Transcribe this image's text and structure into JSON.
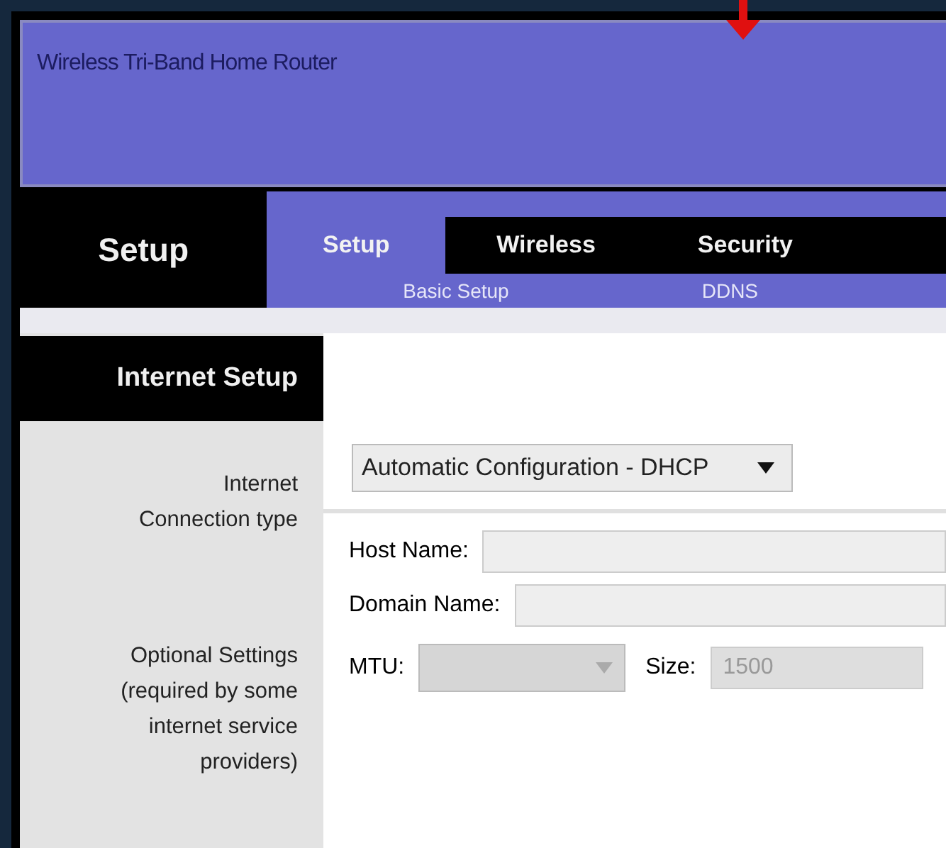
{
  "header": {
    "title": "Wireless Tri-Band Home Router"
  },
  "section": {
    "title": "Setup"
  },
  "tabs": [
    {
      "label": "Setup",
      "selected": true
    },
    {
      "label": "Wireless",
      "selected": false
    },
    {
      "label": "Security",
      "selected": false
    }
  ],
  "subtabs": [
    {
      "label": "Basic Setup"
    },
    {
      "label": "DDNS"
    }
  ],
  "panel": {
    "title": "Internet Setup"
  },
  "connection": {
    "label": "Internet Connection type",
    "value": "Automatic Configuration - DHCP"
  },
  "optional": {
    "label": "Optional Settings (required by some internet service providers)",
    "fields": [
      {
        "label": "Host Name:",
        "kind": "text"
      },
      {
        "label": "Domain Name:",
        "kind": "text"
      },
      {
        "label": "MTU:",
        "kind": "dropdown",
        "disabled": true
      },
      {
        "label": "Size:",
        "kind": "text",
        "value": "1500",
        "disabled": true
      }
    ]
  }
}
